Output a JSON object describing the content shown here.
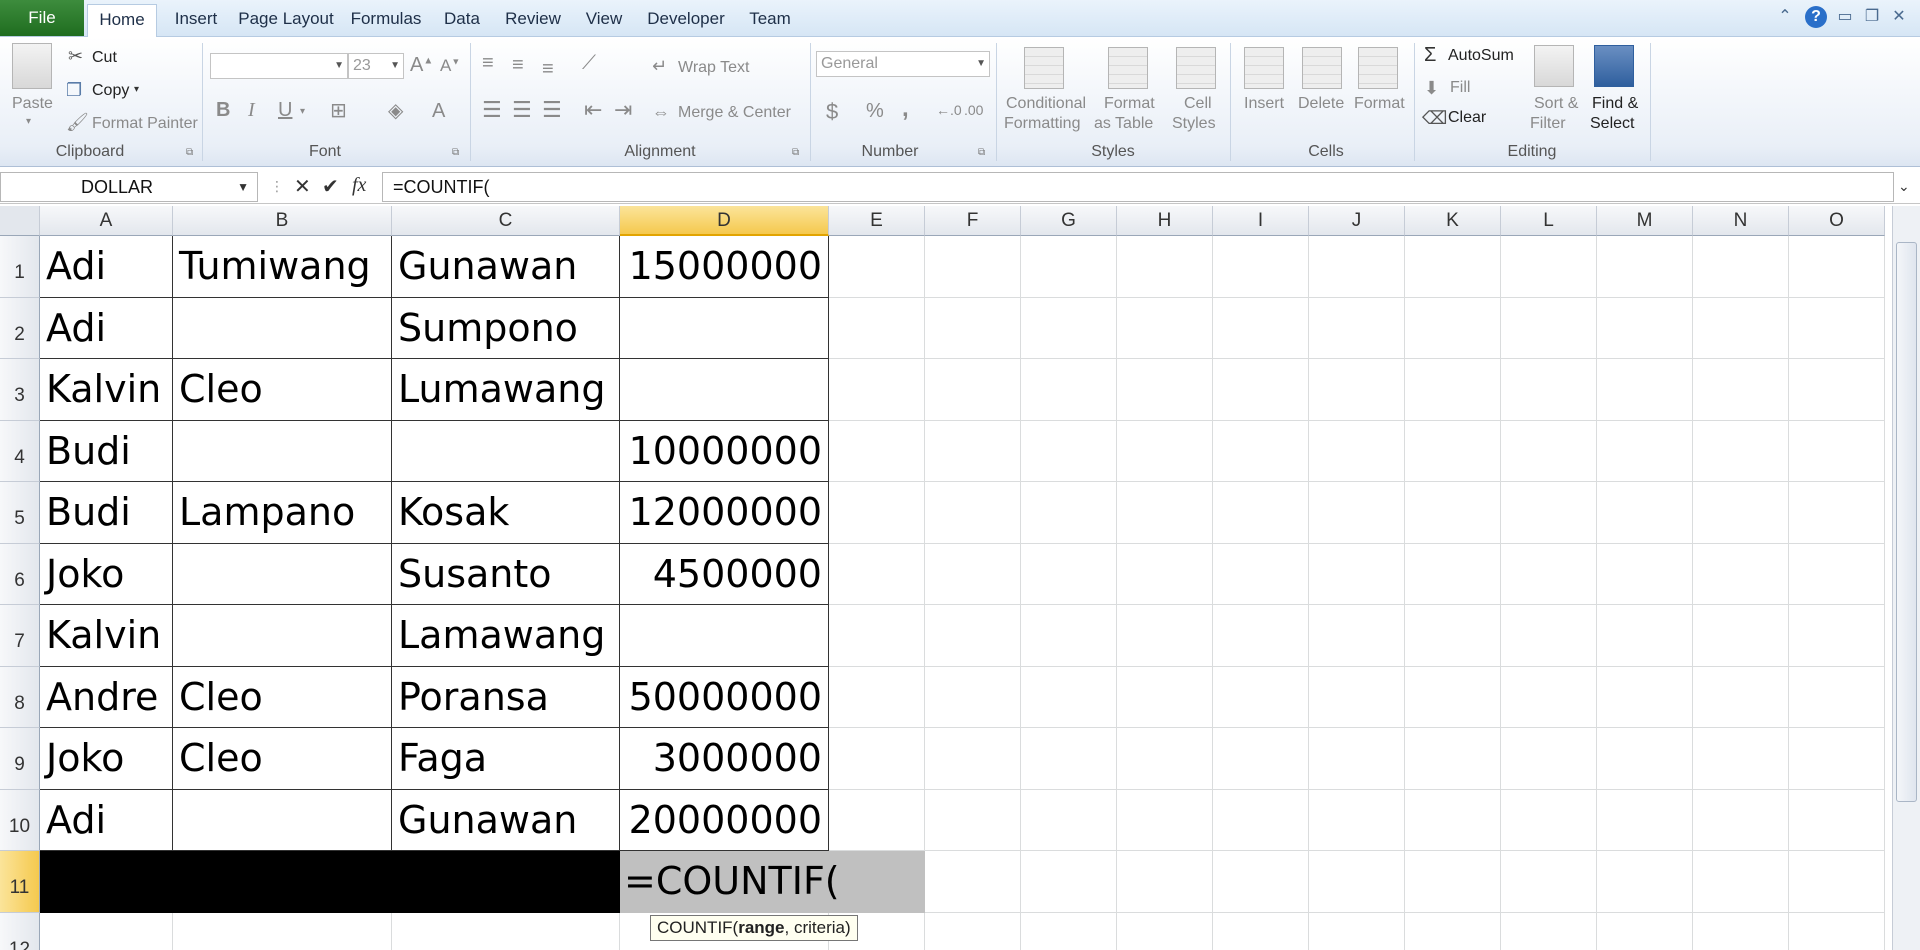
{
  "tabs": [
    "File",
    "Home",
    "Insert",
    "Page Layout",
    "Formulas",
    "Data",
    "Review",
    "View",
    "Developer",
    "Team"
  ],
  "ribbon": {
    "clipboard": {
      "paste": "Paste",
      "cut": "Cut",
      "copy": "Copy",
      "format_painter": "Format Painter",
      "label": "Clipboard"
    },
    "font": {
      "font_name": "",
      "font_size": "23",
      "bold": "B",
      "italic": "I",
      "underline": "U",
      "label": "Font"
    },
    "alignment": {
      "wrap_text": "Wrap Text",
      "merge_center": "Merge & Center",
      "label": "Alignment"
    },
    "number": {
      "format": "General",
      "currency": "$",
      "percent": "%",
      "comma": ",",
      "inc_decimal": ".0→.00",
      "dec_decimal": ".00→.0",
      "label": "Number"
    },
    "styles": {
      "conditional_1": "Conditional",
      "conditional_2": "Formatting",
      "format_table_1": "Format",
      "format_table_2": "as Table",
      "cell_styles_1": "Cell",
      "cell_styles_2": "Styles",
      "label": "Styles"
    },
    "cells": {
      "insert": "Insert",
      "delete": "Delete",
      "format": "Format",
      "label": "Cells"
    },
    "editing": {
      "autosum": "AutoSum",
      "fill": "Fill",
      "clear": "Clear",
      "sort_1": "Sort &",
      "sort_2": "Filter",
      "find_1": "Find &",
      "find_2": "Select",
      "label": "Editing"
    }
  },
  "formula_bar": {
    "name_box": "DOLLAR",
    "formula": "=COUNTIF("
  },
  "columns": [
    "A",
    "B",
    "C",
    "D",
    "E",
    "F",
    "G",
    "H",
    "I",
    "J",
    "K",
    "L",
    "M",
    "N",
    "O"
  ],
  "rows": [
    {
      "num": "1",
      "a": "Adi",
      "b": "Tumiwang",
      "c": "Gunawan",
      "d": "15000000"
    },
    {
      "num": "2",
      "a": "Adi",
      "b": "",
      "c": "Sumpono",
      "d": ""
    },
    {
      "num": "3",
      "a": "Kalvin",
      "b": "Cleo",
      "c": "Lumawang",
      "d": ""
    },
    {
      "num": "4",
      "a": "Budi",
      "b": "",
      "c": "",
      "d": "10000000"
    },
    {
      "num": "5",
      "a": "Budi",
      "b": "Lampano",
      "c": "Kosak",
      "d": "12000000"
    },
    {
      "num": "6",
      "a": "Joko",
      "b": "",
      "c": "Susanto",
      "d": "4500000"
    },
    {
      "num": "7",
      "a": "Kalvin",
      "b": "",
      "c": "Lamawang",
      "d": ""
    },
    {
      "num": "8",
      "a": "Andre",
      "b": "Cleo",
      "c": "Poransa",
      "d": "50000000"
    },
    {
      "num": "9",
      "a": "Joko",
      "b": "Cleo",
      "c": "Faga",
      "d": "3000000"
    },
    {
      "num": "10",
      "a": "Adi",
      "b": "",
      "c": "Gunawan",
      "d": "20000000"
    }
  ],
  "row11": {
    "num": "11",
    "active_value": "=COUNTIF("
  },
  "row12": {
    "num": "12"
  },
  "tooltip": {
    "fn": "COUNTIF(",
    "arg1": "range",
    "rest": ", criteria)"
  }
}
